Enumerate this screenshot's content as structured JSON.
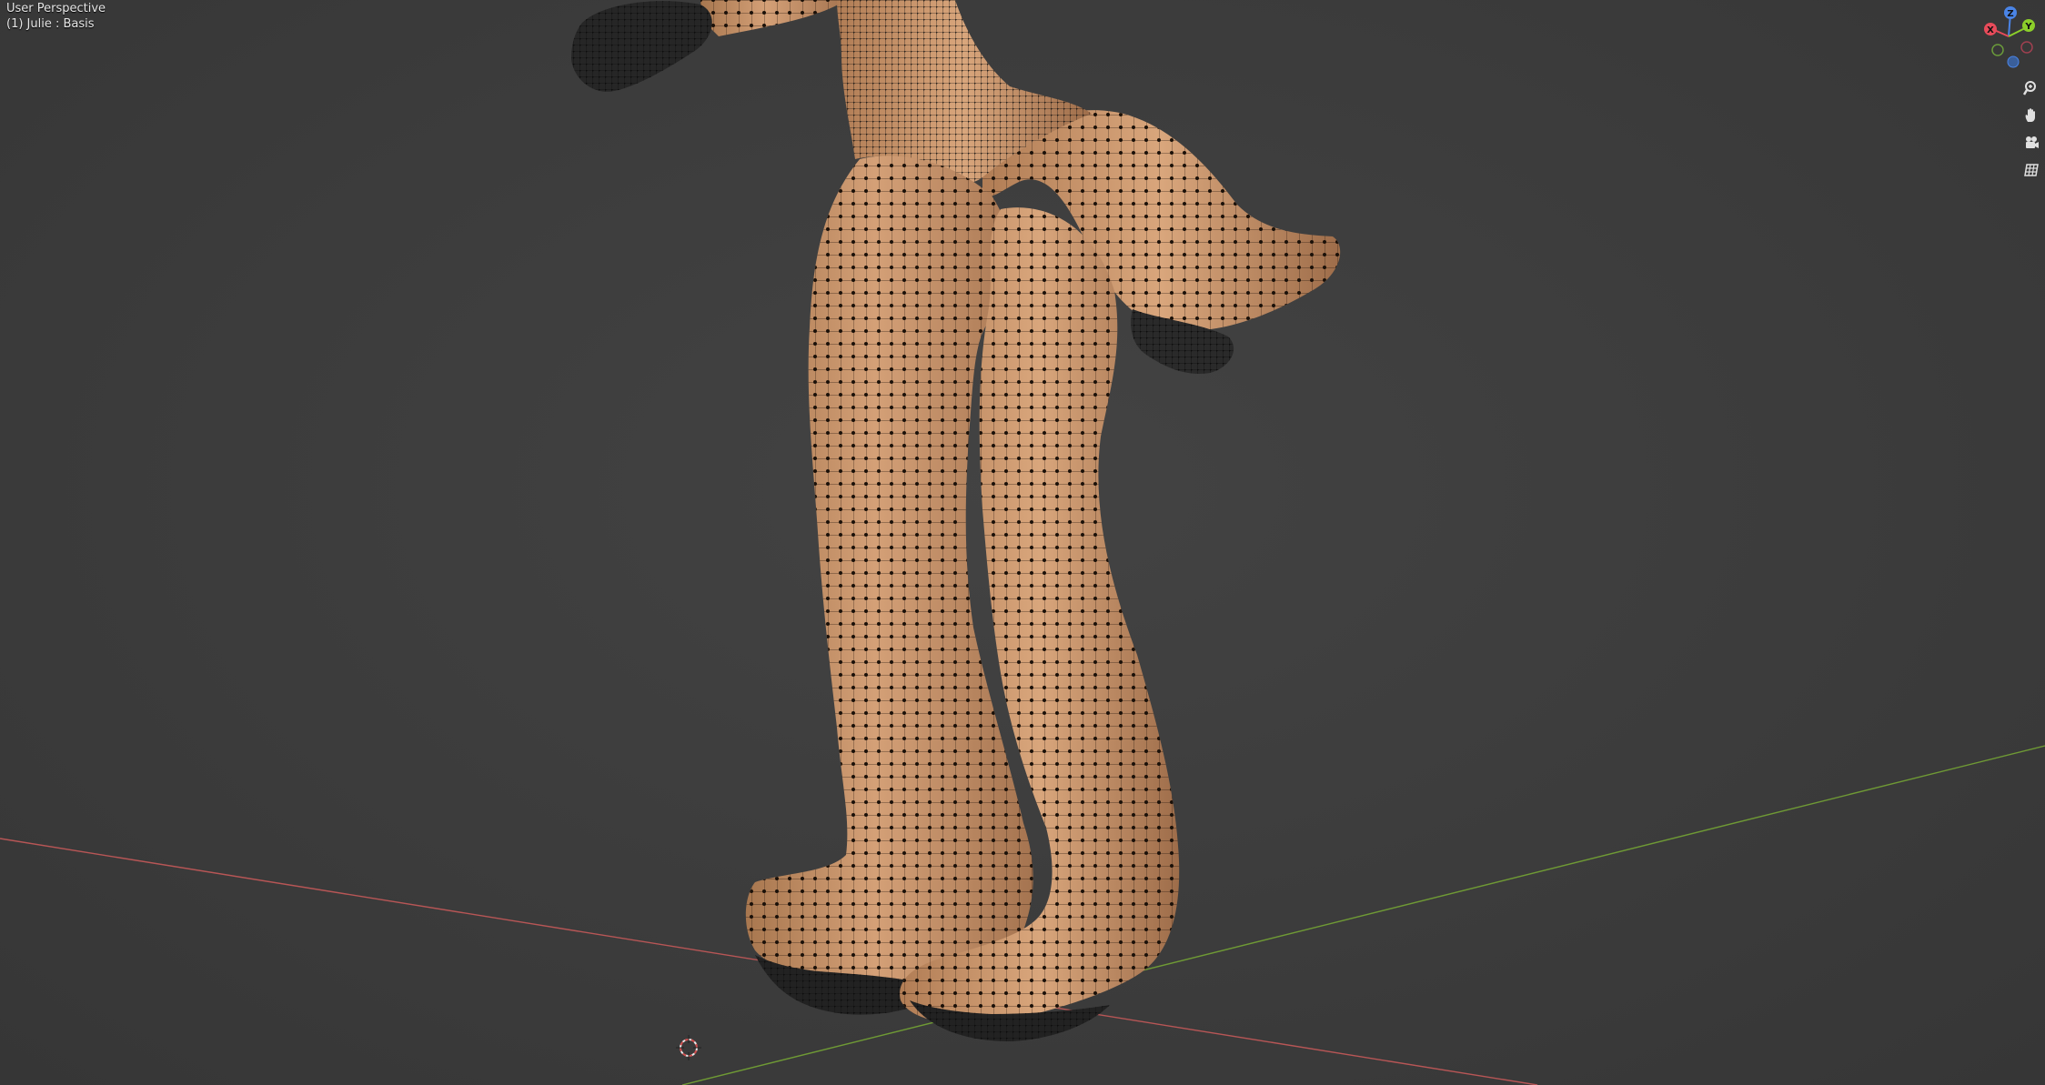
{
  "viewport": {
    "view_label": "User Perspective",
    "object_label": "(1) Julie : Basis"
  },
  "gizmo": {
    "axes": [
      {
        "label": "Z",
        "color": "#4a84e6"
      },
      {
        "label": "Y",
        "color": "#8ccf2a"
      },
      {
        "label": "X",
        "color": "#e84b5a"
      }
    ]
  },
  "nav_buttons": [
    {
      "icon": "zoom-icon"
    },
    {
      "icon": "hand-pan-icon"
    },
    {
      "icon": "camera-icon"
    },
    {
      "icon": "grid-ortho-icon"
    }
  ],
  "colors": {
    "background": "#3d3d3d",
    "mesh_skin": "#c8956a",
    "wire": "#1a1a1a",
    "x_axis_line": "#c75a5a",
    "y_axis_line": "#7aa63a"
  }
}
